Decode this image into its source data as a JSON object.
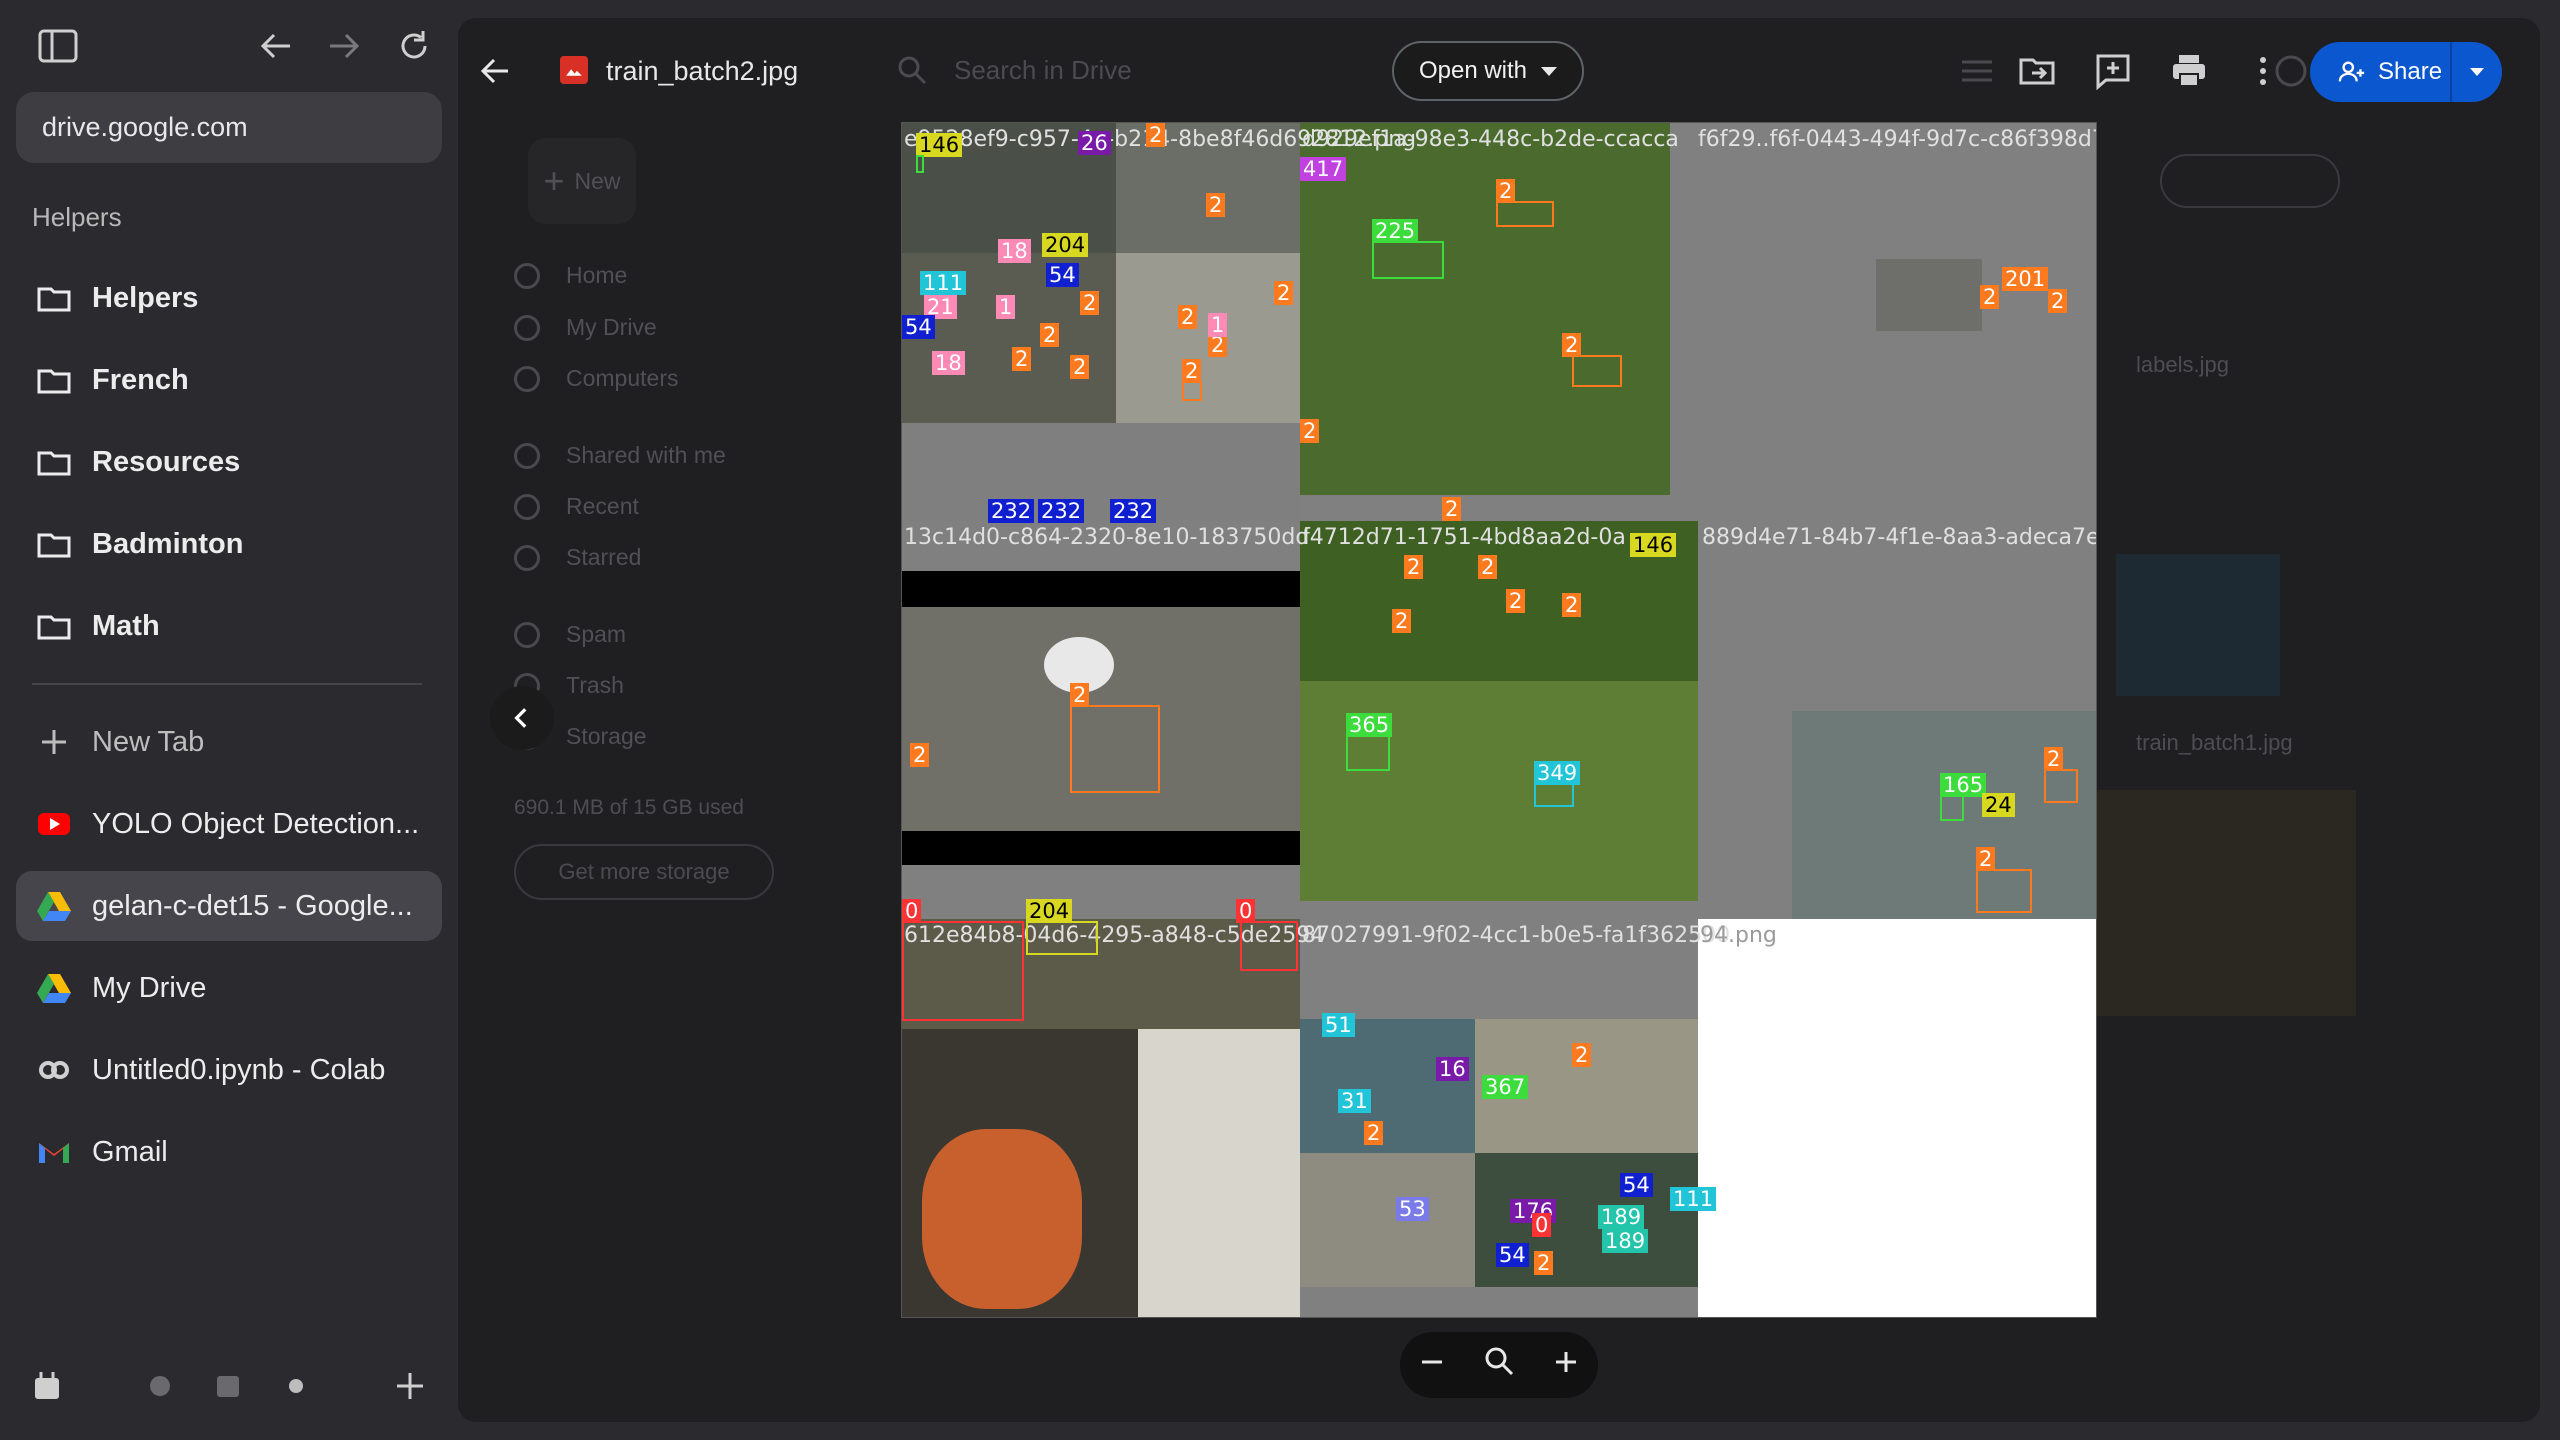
{
  "browser": {
    "url": "drive.google.com",
    "section": "Helpers",
    "folders": [
      {
        "label": "Helpers"
      },
      {
        "label": "French"
      },
      {
        "label": "Resources"
      },
      {
        "label": "Badminton"
      },
      {
        "label": "Math"
      }
    ],
    "new_tab": "New Tab",
    "tabs": [
      {
        "label": "YOLO Object Detection...",
        "icon": "youtube-icon"
      },
      {
        "label": "gelan-c-det15 - Google...",
        "icon": "drive-icon",
        "active": true
      },
      {
        "label": "My Drive",
        "icon": "drive-icon"
      },
      {
        "label": "Untitled0.ipynb - Colab",
        "icon": "colab-icon"
      },
      {
        "label": "Gmail",
        "icon": "gmail-icon"
      }
    ]
  },
  "viewer": {
    "file_name": "train_batch2.jpg",
    "search_placeholder": "Search in Drive",
    "open_with": "Open with",
    "share": "Share"
  },
  "drive_background": {
    "new_label": "New",
    "nav": [
      "Home",
      "My Drive",
      "Computers",
      "Shared with me",
      "Recent",
      "Starred",
      "Spam",
      "Trash",
      "Storage"
    ],
    "storage_used": "690.1 MB of 15 GB used",
    "get_storage": "Get more storage",
    "files": [
      "labels.jpg",
      "train_batch1.jpg"
    ]
  },
  "image": {
    "tile_names": [
      "e9528ef9-c957-4a-b214-8be8f46d692812.png",
      "d929ef1a-98e3-448c-b2de-ccacca",
      "f6f29..f6f-0443-494f-9d7c-c86f398d7e",
      "13c14d0-c864-2320-8e10-183750dd",
      "f4712d71-1751-4bd8aa2d-0a",
      "889d4e71-84b7-4f1e-8aa3-adeca7ea",
      "612e84b8-04d6-4295-a848-c5de2594",
      "87027991-9f02-4cc1-b0e5-fa1f362500",
      "94.png"
    ],
    "labels": [
      "146",
      "26",
      "2",
      "417",
      "225",
      "2",
      "2",
      "18",
      "204",
      "54",
      "111",
      "21",
      "1",
      "54",
      "18",
      "2",
      "2",
      "2",
      "2",
      "2",
      "1",
      "2",
      "2",
      "2",
      "2",
      "2",
      "232",
      "232",
      "232",
      "2",
      "2",
      "365",
      "349",
      "146",
      "2",
      "2",
      "2",
      "2",
      "2",
      "2",
      "165",
      "24",
      "2",
      "2",
      "0",
      "204",
      "0",
      "51",
      "16",
      "367",
      "31",
      "2",
      "53",
      "176",
      "0",
      "189",
      "189",
      "54",
      "2",
      "111",
      "2",
      "54",
      "2",
      "201",
      "2"
    ]
  },
  "colors": {
    "accent": "#0b57d0",
    "orange_box": "#ff7a1f",
    "green_box": "#3ddc3d",
    "blue_box": "#1020d0",
    "yellow_box": "#d8d820",
    "pink_box": "#ff8ab5",
    "cyan_box": "#22c4d8",
    "purple_box": "#7a1aa8",
    "red_box": "#ff3333"
  }
}
